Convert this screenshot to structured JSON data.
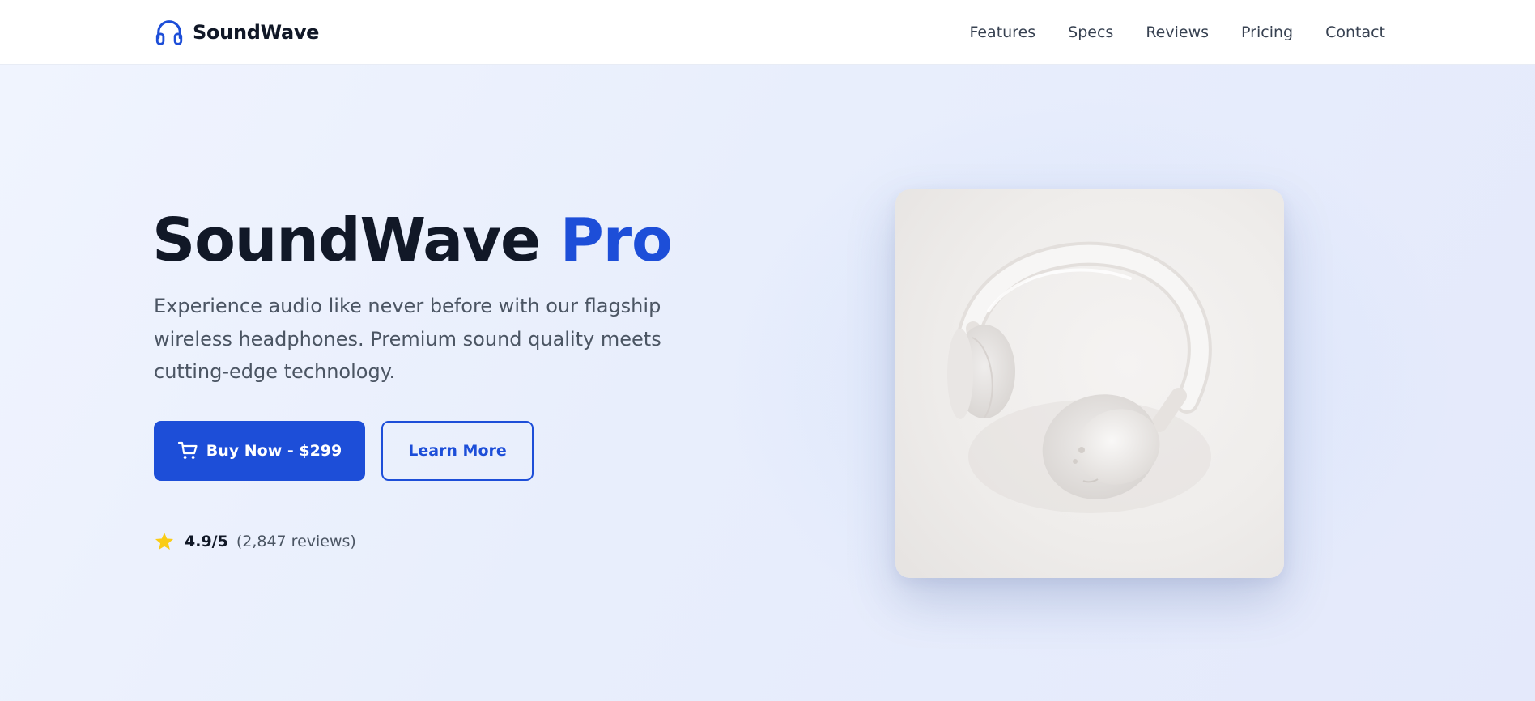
{
  "nav": {
    "brand": "SoundWave",
    "links": [
      "Features",
      "Specs",
      "Reviews",
      "Pricing",
      "Contact"
    ]
  },
  "hero": {
    "title_main": "SoundWave",
    "title_accent": "Pro",
    "subtitle": "Experience audio like never before with our flagship wireless headphones. Premium sound quality meets cutting-edge technology.",
    "buy_label": "Buy Now - $299",
    "learn_label": "Learn More",
    "rating_score": "4.9/5",
    "rating_count": "(2,847 reviews)"
  },
  "icons": {
    "brand": "headphones-icon",
    "buy": "cart-icon",
    "rating": "star-icon",
    "product": "headphones-image"
  },
  "colors": {
    "accent": "#1d4ed8",
    "heading": "#111827",
    "body_text": "#4b5563",
    "star": "#facc15",
    "hero_bg": "#eef2fd"
  }
}
